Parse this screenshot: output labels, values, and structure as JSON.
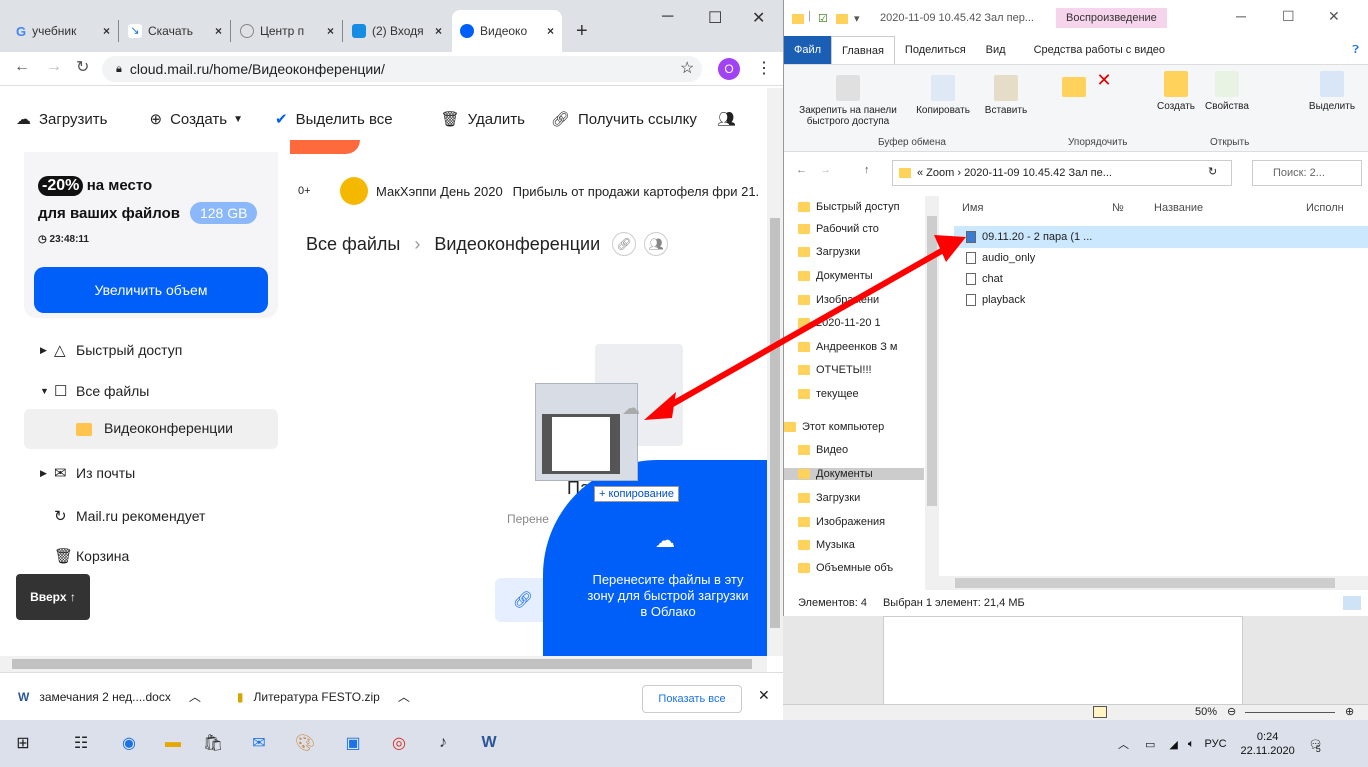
{
  "chrome": {
    "tabs": [
      {
        "label": "учебник"
      },
      {
        "label": "Скачать"
      },
      {
        "label": "Центр п"
      },
      {
        "label": "(2) Входя"
      },
      {
        "label": "Видеоко"
      }
    ],
    "new_tab": "+",
    "url": "cloud.mail.ru/home/Видеоконференции/",
    "profile_letter": "O"
  },
  "cloud": {
    "toolbar": {
      "upload": "Загрузить",
      "create": "Создать",
      "select_all": "Выделить все",
      "delete": "Удалить",
      "get_link": "Получить ссылку"
    },
    "promo": {
      "discount": "-20%",
      "line1": "на место",
      "line2": "для ваших файлов",
      "size": "128 GB",
      "timer": "23:48:11",
      "button": "Увеличить объем"
    },
    "nav": {
      "quick": "Быстрый доступ",
      "all": "Все файлы",
      "video": "Видеоконференции",
      "mail": "Из почты",
      "recommend": "Mail.ru рекомендует",
      "trash": "Корзина"
    },
    "up": "Вверх ↑",
    "news": {
      "count": "0+",
      "title": "МакХэппи День 2020",
      "text": "Прибыль от продажи картофеля фри 21."
    },
    "breadcrumb": {
      "root": "Все файлы",
      "current": "Видеоконференции"
    },
    "empty_title": "Па",
    "empty_sub": "Перене",
    "drag_label": "+ копирование",
    "drop_text": "Перенесите файлы в эту зону для быстрой загрузки в Облако"
  },
  "downloads": {
    "items": [
      "замечания 2 нед....docx",
      "Литература FESTO.zip"
    ],
    "show_all": "Показать все"
  },
  "explorer": {
    "title": "2020-11-09 10.45.42 Зал пер...",
    "play_tab": "Воспроизведение",
    "tabs": [
      "Файл",
      "Главная",
      "Поделиться",
      "Вид",
      "Средства работы с видео"
    ],
    "ribbon": {
      "pin": "Закрепить на панели быстрого доступа",
      "copy": "Копировать",
      "paste": "Вставить",
      "create": "Создать",
      "props": "Свойства",
      "select": "Выделить",
      "g_clip": "Буфер обмена",
      "g_org": "Упорядочить",
      "g_open": "Открыть"
    },
    "address": "« Zoom › 2020-11-09 10.45.42 Зал пе...",
    "search": "Поиск: 2...",
    "nav": [
      "Быстрый доступ",
      "Рабочий сто",
      "Загрузки",
      "Документы",
      "Изображени",
      "2020-11-20 1",
      "Андреенков З м",
      "ОТЧЕТЫ!!!",
      "текущее",
      "Этот компьютер",
      "Видео",
      "Документы",
      "Загрузки",
      "Изображения",
      "Музыка",
      "Объемные объ"
    ],
    "columns": [
      "Имя",
      "№",
      "Название",
      "Исполн"
    ],
    "files": [
      "09.11.20 - 2 пара (1 ...",
      "audio_only",
      "chat",
      "playback"
    ],
    "status_count": "Элементов: 4",
    "status_sel": "Выбран 1 элемент: 21,4 МБ"
  },
  "word": {
    "zoom": "50%"
  },
  "taskbar": {
    "lang": "РУС",
    "time": "0:24",
    "date": "22.11.2020",
    "notif": "5"
  },
  "colors": {
    "arrow": "#ff0000",
    "brand": "#005ff9"
  }
}
